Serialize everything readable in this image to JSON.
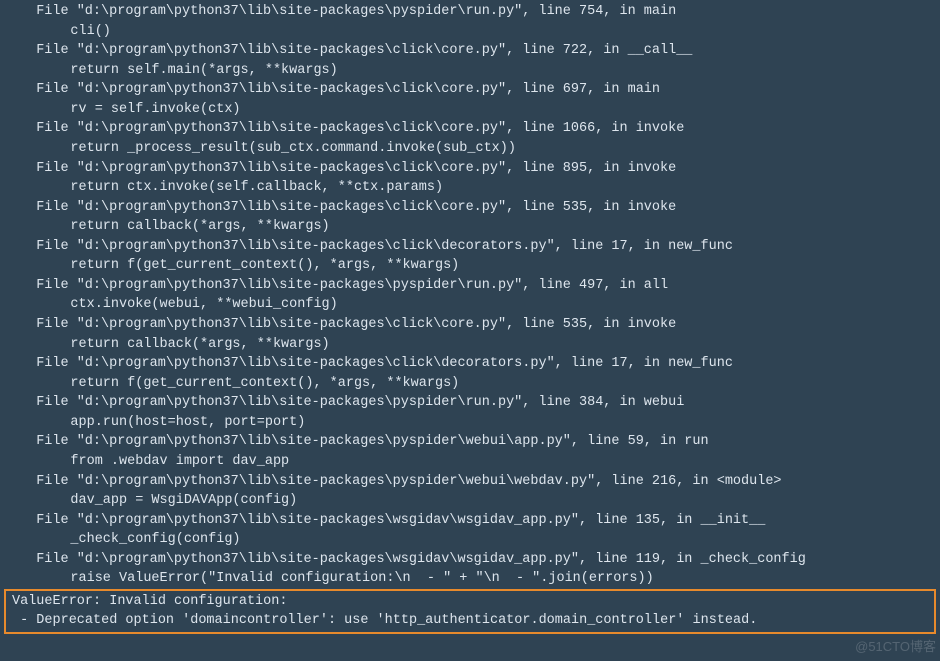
{
  "traceback": [
    {
      "file": "  File \"d:\\program\\python37\\lib\\site-packages\\pyspider\\run.py\", line 754, in main",
      "code": "    cli()"
    },
    {
      "file": "  File \"d:\\program\\python37\\lib\\site-packages\\click\\core.py\", line 722, in __call__",
      "code": "    return self.main(*args, **kwargs)"
    },
    {
      "file": "  File \"d:\\program\\python37\\lib\\site-packages\\click\\core.py\", line 697, in main",
      "code": "    rv = self.invoke(ctx)"
    },
    {
      "file": "  File \"d:\\program\\python37\\lib\\site-packages\\click\\core.py\", line 1066, in invoke",
      "code": "    return _process_result(sub_ctx.command.invoke(sub_ctx))"
    },
    {
      "file": "  File \"d:\\program\\python37\\lib\\site-packages\\click\\core.py\", line 895, in invoke",
      "code": "    return ctx.invoke(self.callback, **ctx.params)"
    },
    {
      "file": "  File \"d:\\program\\python37\\lib\\site-packages\\click\\core.py\", line 535, in invoke",
      "code": "    return callback(*args, **kwargs)"
    },
    {
      "file": "  File \"d:\\program\\python37\\lib\\site-packages\\click\\decorators.py\", line 17, in new_func",
      "code": "    return f(get_current_context(), *args, **kwargs)"
    },
    {
      "file": "  File \"d:\\program\\python37\\lib\\site-packages\\pyspider\\run.py\", line 497, in all",
      "code": "    ctx.invoke(webui, **webui_config)"
    },
    {
      "file": "  File \"d:\\program\\python37\\lib\\site-packages\\click\\core.py\", line 535, in invoke",
      "code": "    return callback(*args, **kwargs)"
    },
    {
      "file": "  File \"d:\\program\\python37\\lib\\site-packages\\click\\decorators.py\", line 17, in new_func",
      "code": "    return f(get_current_context(), *args, **kwargs)"
    },
    {
      "file": "  File \"d:\\program\\python37\\lib\\site-packages\\pyspider\\run.py\", line 384, in webui",
      "code": "    app.run(host=host, port=port)"
    },
    {
      "file": "  File \"d:\\program\\python37\\lib\\site-packages\\pyspider\\webui\\app.py\", line 59, in run",
      "code": "    from .webdav import dav_app"
    },
    {
      "file": "  File \"d:\\program\\python37\\lib\\site-packages\\pyspider\\webui\\webdav.py\", line 216, in <module>",
      "code": "    dav_app = WsgiDAVApp(config)"
    },
    {
      "file": "  File \"d:\\program\\python37\\lib\\site-packages\\wsgidav\\wsgidav_app.py\", line 135, in __init__",
      "code": "    _check_config(config)"
    },
    {
      "file": "  File \"d:\\program\\python37\\lib\\site-packages\\wsgidav\\wsgidav_app.py\", line 119, in _check_config",
      "code": "    raise ValueError(\"Invalid configuration:\\n  - \" + \"\\n  - \".join(errors))"
    }
  ],
  "error": {
    "headline": "ValueError: Invalid configuration:",
    "detail": " - Deprecated option 'domaincontroller': use 'http_authenticator.domain_controller' instead."
  },
  "watermark": "@51CTO博客"
}
